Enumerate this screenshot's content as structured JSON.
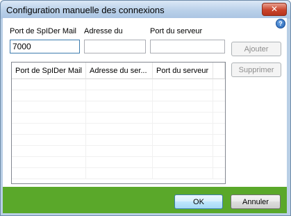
{
  "window": {
    "title": "Configuration manuelle des connexions",
    "close_label": "✕",
    "help_label": "?"
  },
  "form": {
    "port_spider_label": "Port de SpIDer Mail",
    "port_spider_value": "7000",
    "address_label": "Adresse du",
    "address_value": "",
    "server_port_label": "Port du serveur",
    "server_port_value": ""
  },
  "buttons": {
    "add": "Ajouter",
    "remove": "Supprimer",
    "ok": "OK",
    "cancel": "Annuler"
  },
  "list": {
    "columns": [
      "Port de SpIDer Mail",
      "Adresse du ser...",
      "Port du serveur"
    ]
  },
  "colors": {
    "footer": "#5aa82a",
    "titlebar": "#b9d0e9"
  }
}
